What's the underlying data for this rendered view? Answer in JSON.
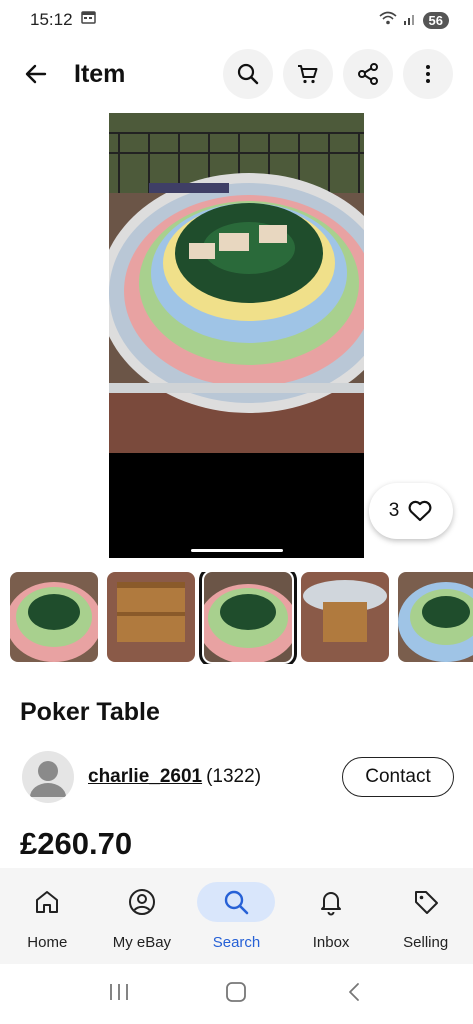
{
  "status_bar": {
    "time": "15:12",
    "battery": "56"
  },
  "header": {
    "title": "Item"
  },
  "item": {
    "watch_count": "3",
    "title": "Poker Table",
    "price": "£260.70"
  },
  "seller": {
    "name": "charlie_2601",
    "feedback": "(1322)",
    "contact_label": "Contact"
  },
  "bottom_nav": {
    "items": [
      {
        "label": "Home",
        "icon": "home-icon"
      },
      {
        "label": "My eBay",
        "icon": "account-icon"
      },
      {
        "label": "Search",
        "icon": "search-icon",
        "active": true
      },
      {
        "label": "Inbox",
        "icon": "bell-icon"
      },
      {
        "label": "Selling",
        "icon": "tag-icon"
      }
    ]
  },
  "colors": {
    "accent": "#2761d6",
    "active_bg": "#d9e6fb"
  }
}
